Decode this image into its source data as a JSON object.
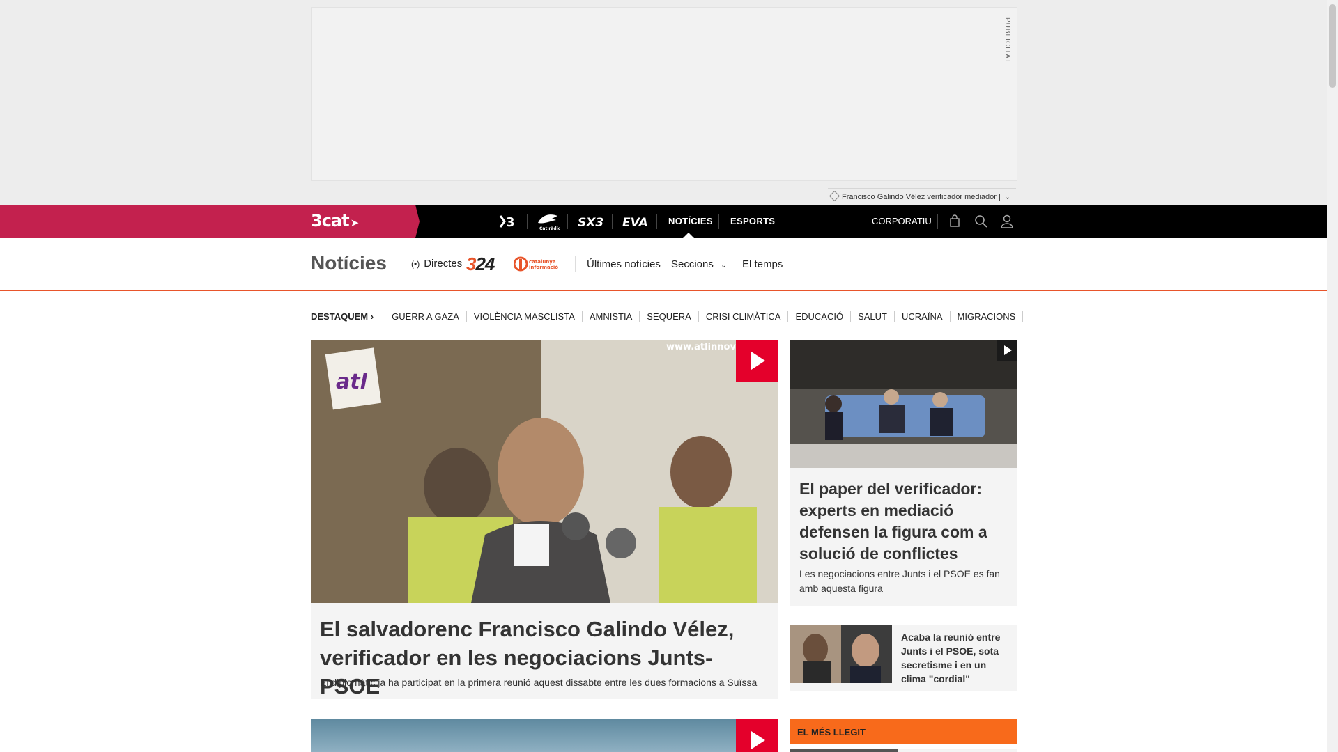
{
  "ad": {
    "label": "PUBLICITAT",
    "tagline": "Francisco Galindo Vélez verificador mediador |"
  },
  "topbar": {
    "logo": "3cat",
    "channels": [
      {
        "id": "tv3",
        "text": "▸3"
      },
      {
        "id": "catradio",
        "text": "Cat ràdio"
      },
      {
        "id": "sx3",
        "text": "SX3"
      },
      {
        "id": "eva",
        "text": "EVA"
      }
    ],
    "nav": [
      "NOTÍCIES",
      "ESPORTS"
    ],
    "active": "NOTÍCIES",
    "corporate": "CORPORATIU",
    "icons": [
      "shopping-bag-icon",
      "search-icon",
      "user-icon"
    ],
    "colors": {
      "brand": "#c3214e",
      "bar": "#000000"
    }
  },
  "section": {
    "title": "Notícies",
    "directes": "Directes",
    "logo_324": "324",
    "logo_cati": "catalunya informació",
    "links": [
      "Últimes notícies",
      "Seccions",
      "El temps"
    ],
    "accent": "#e8552b"
  },
  "tags": {
    "lead": "DESTAQUEM",
    "items": [
      "GUERR A GAZA",
      "VIOLÈNCIA MASCLISTA",
      "AMNISTIA",
      "SEQUERA",
      "CRISI CLIMÀTICA",
      "EDUCACIÓ",
      "SALUT",
      "UCRAÏNA",
      "MIGRACIONS"
    ]
  },
  "main_story": {
    "image_text": "www.atlinnovac",
    "image_logo": "atl",
    "title": "El salvadorenc Francisco Galindo Vélez, verificador en les negociacions Junts-PSOE",
    "subtitle": "El diplomàtic ja ha participat en la primera reunió aquest dissabte entre les dues formacions a Suïssa"
  },
  "side_story": {
    "title": "El paper del verificador: experts en mediació defensen la figura com a solució de conflictes",
    "subtitle": "Les negociacions entre Junts i el PSOE es fan amb aquesta figura"
  },
  "mini_story": {
    "title": "Acaba la reunió entre Junts i el PSOE, sota secretisme i en un clima \"cordial\""
  },
  "most_read": {
    "title": "EL MÉS LLEGIT",
    "color": "#f86a1b"
  }
}
